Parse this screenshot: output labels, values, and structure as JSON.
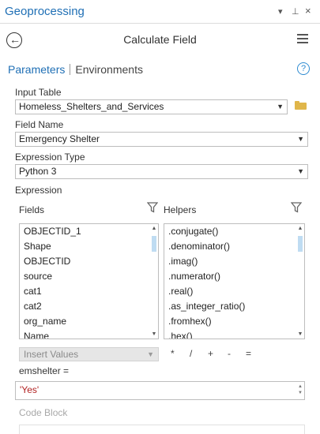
{
  "pane": {
    "title": "Geoprocessing",
    "controls": {
      "dropdown": "▾",
      "pin": "⊥",
      "close": "×"
    }
  },
  "tool": {
    "back_glyph": "←",
    "title": "Calculate Field"
  },
  "tabs": {
    "parameters": "Parameters",
    "environments": "Environments",
    "help": "?"
  },
  "params": {
    "input_table": {
      "label": "Input Table",
      "value": "Homeless_Shelters_and_Services"
    },
    "field_name": {
      "label": "Field Name",
      "value": "Emergency Shelter"
    },
    "expression_type": {
      "label": "Expression Type",
      "value": "Python 3"
    },
    "expression_label": "Expression"
  },
  "fields": {
    "label": "Fields",
    "items": [
      "OBJECTID_1",
      "Shape",
      "OBJECTID",
      "source",
      "cat1",
      "cat2",
      "org_name",
      "Name"
    ]
  },
  "helpers": {
    "label": "Helpers",
    "items": [
      ".conjugate()",
      ".denominator()",
      ".imag()",
      ".numerator()",
      ".real()",
      ".as_integer_ratio()",
      ".fromhex()",
      ".hex()"
    ]
  },
  "insert_values": "Insert Values",
  "operators": [
    "*",
    "/",
    "+",
    "-",
    "="
  ],
  "expression": {
    "target": "emshelter =",
    "value": "'Yes'"
  },
  "code_block": {
    "label": "Code Block"
  },
  "colors": {
    "accent": "#1f6fb5",
    "string_literal": "#b22222",
    "folder": "#e0b64a"
  }
}
